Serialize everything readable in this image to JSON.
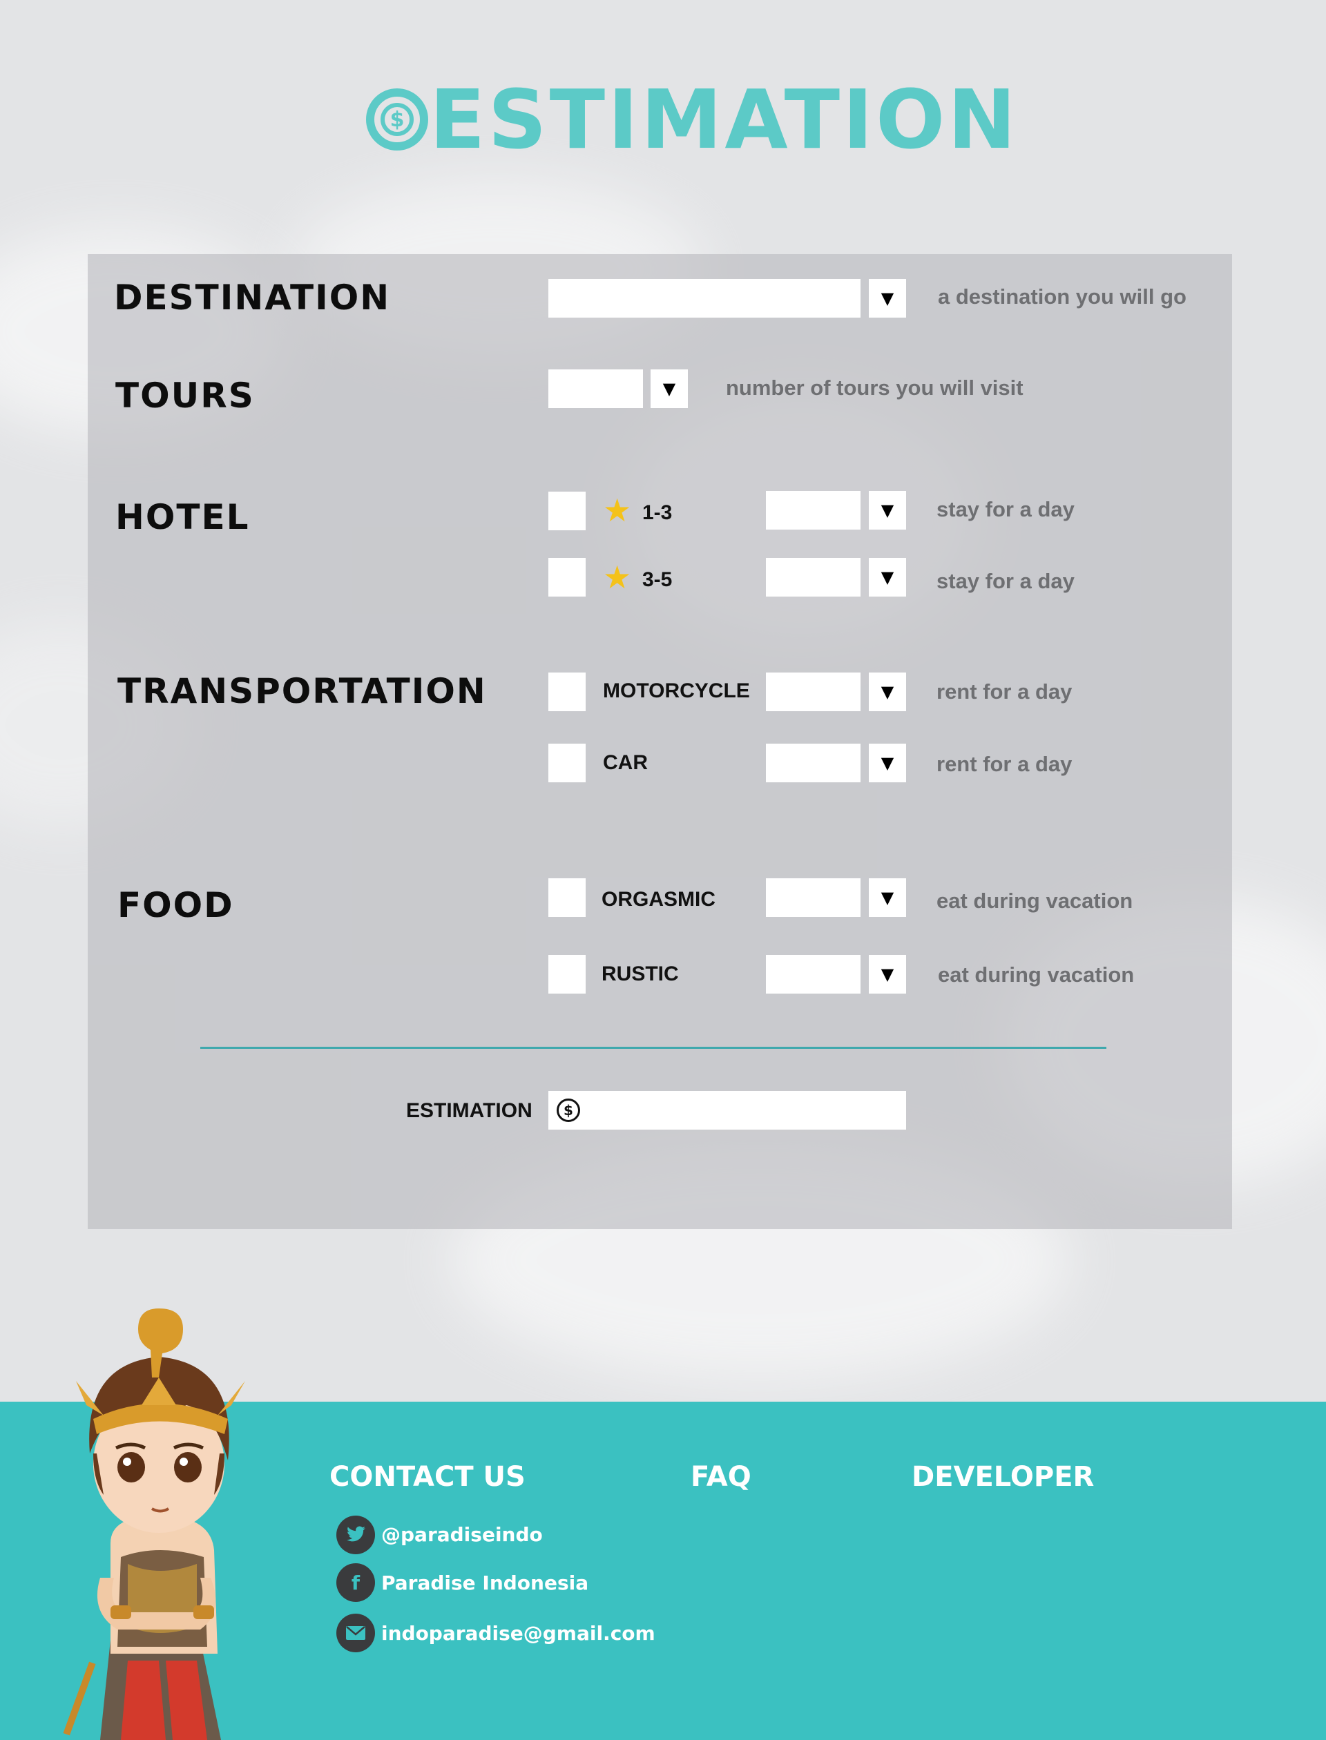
{
  "header": {
    "title_text": "ESTIMATION",
    "title_icon": "dollar-coin-icon",
    "accent_color": "#5ccac7"
  },
  "form": {
    "destination": {
      "label": "DESTINATION",
      "value": "",
      "hint": "a destination you will go"
    },
    "tours": {
      "label": "TOURS",
      "value": "",
      "hint": "number of tours you will visit"
    },
    "hotel": {
      "label": "HOTEL",
      "options": [
        {
          "rating": "1-3",
          "checked": false,
          "value": "",
          "hint": "stay for a day"
        },
        {
          "rating": "3-5",
          "checked": false,
          "value": "",
          "hint": "stay for a day"
        }
      ]
    },
    "transportation": {
      "label": "TRANSPORTATION",
      "options": [
        {
          "label": "MOTORCYCLE",
          "checked": false,
          "value": "",
          "hint": "rent for a day"
        },
        {
          "label": "CAR",
          "checked": false,
          "value": "",
          "hint": "rent for a day"
        }
      ]
    },
    "food": {
      "label": "FOOD",
      "options": [
        {
          "label": "ORGASMIC",
          "checked": false,
          "value": "",
          "hint": "eat during vacation"
        },
        {
          "label": "RUSTIC",
          "checked": false,
          "value": "",
          "hint": "eat during vacation"
        }
      ]
    },
    "dropdown_arrow": "▼",
    "estimation": {
      "label": "ESTIMATION",
      "currency_symbol": "$",
      "value": ""
    }
  },
  "footer": {
    "background_color": "#3bc1c1",
    "contact": {
      "heading": "CONTACT US",
      "twitter": {
        "icon": "twitter-icon",
        "text": "@paradiseindo"
      },
      "facebook": {
        "icon": "facebook-icon",
        "text": "Paradise Indonesia"
      },
      "email": {
        "icon": "mail-icon",
        "text": "indoparadise@gmail.com"
      }
    },
    "faq_heading": "FAQ",
    "developer_heading": "DEVELOPER"
  }
}
